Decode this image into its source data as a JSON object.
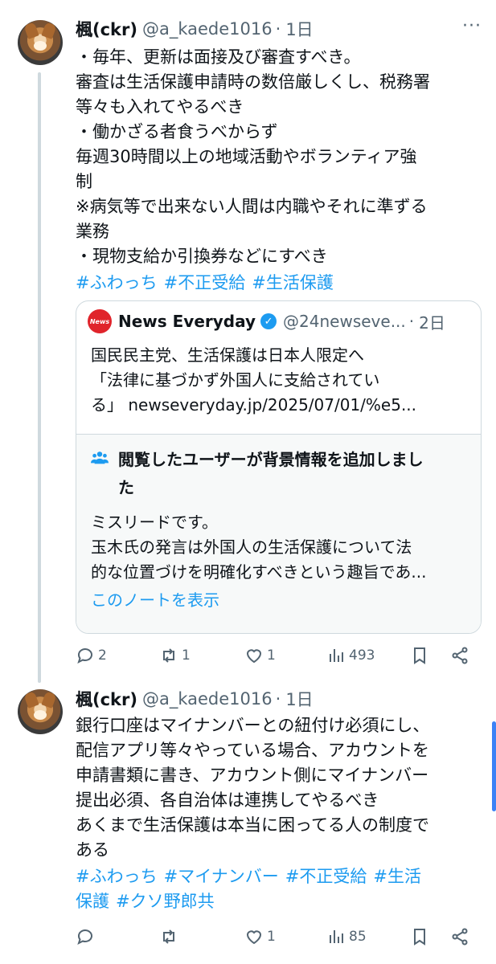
{
  "tweets": [
    {
      "author_name": "楓(ckr)",
      "handle": "@a_kaede1016",
      "separator": "·",
      "time": "1日",
      "more": "···",
      "text": "・毎年、更新は面接及び審査すべき。\n審査は生活保護申請時の数倍厳しくし、税務署\n等々も入れてやるべき\n・働かざる者食うべからず\n毎週30時間以上の地域活動やボランティア強\n制\n※病気等で出来ない人間は内職やそれに準ずる\n業務\n・現物支給か引換券などにすべき",
      "hashtags": [
        "#ふわっち",
        "#不正受給",
        "#生活保護"
      ],
      "replies": "2",
      "retweets": "1",
      "likes": "1",
      "views": "493"
    },
    {
      "author_name": "楓(ckr)",
      "handle": "@a_kaede1016",
      "separator": "·",
      "time": "1日",
      "text": "銀行口座はマイナンバーとの紐付け必須にし、\n配信アプリ等々やっている場合、アカウントを\n申請書類に書き、アカウント側にマイナンバー\n提出必須、各自治体は連携してやるべき\nあくまで生活保護は本当に困ってる人の制度で\nある",
      "hashtags_line1": [
        "#ふわっち",
        "#マイナンバー",
        "#不正受給",
        "#生活"
      ],
      "hashtags_line2": [
        "保護",
        "#クソ野郎共"
      ],
      "replies": "",
      "retweets": "",
      "likes": "1",
      "views": "85"
    }
  ],
  "quote": {
    "logo_text": "News",
    "name": "News Everyday",
    "verified_mark": "✓",
    "handle": "@24newseve...",
    "separator": "·",
    "time": "2日",
    "text": "国民民主党、生活保護は日本人限定へ\n「法律に基づかず外国人に支給されてい\nる」 newseveryday.jp/2025/07/01/%e5..."
  },
  "community_note": {
    "title": "閲覧したユーザーが背景情報を追加しまし\nた",
    "body": "ミスリードです。\n玉木氏の発言は外国人の生活保護について法\n的な位置づけを明確化すべきという趣旨であ...",
    "link": "このノートを表示"
  },
  "colors": {
    "accent": "#1d9bf0",
    "muted": "#536471",
    "border": "#cfd9de",
    "news_red": "#e0242b",
    "scrollbar": "#3b82f6"
  },
  "icons": [
    "more-icon",
    "verified-icon",
    "people-icon",
    "reply-icon",
    "retweet-icon",
    "like-icon",
    "views-icon",
    "bookmark-icon",
    "share-icon"
  ]
}
